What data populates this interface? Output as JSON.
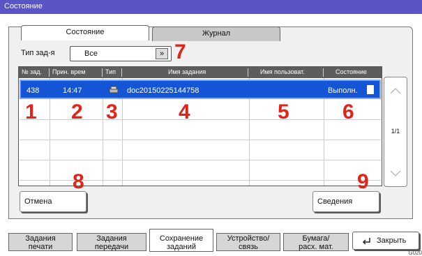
{
  "window": {
    "title": "Состояние"
  },
  "tabs": [
    {
      "label": "Состояние",
      "active": true
    },
    {
      "label": "Журнал",
      "active": false
    }
  ],
  "filter": {
    "label": "Тип зад-я",
    "value": "Все",
    "arrow": "»"
  },
  "table": {
    "columns": [
      "№ зад.",
      "Прин. врем",
      "Тип",
      "Имя задания",
      "Имя пользоват.",
      "Состояние"
    ],
    "rows": [
      {
        "id": "438",
        "time": "14:47",
        "type_icon": "scan-icon",
        "name": "doc20150225144758",
        "user": "",
        "status": "Выполн."
      }
    ]
  },
  "scroll": {
    "page_indicator": "1/1"
  },
  "markers": [
    "1",
    "2",
    "3",
    "4",
    "5",
    "6",
    "7",
    "8",
    "9"
  ],
  "buttons": {
    "cancel": "Отмена",
    "details": "Сведения"
  },
  "bottom_tabs": [
    {
      "label_line1": "Задания",
      "label_line2": "печати",
      "active": false
    },
    {
      "label_line1": "Задания",
      "label_line2": "передачи",
      "active": false
    },
    {
      "label_line1": "Сохранение",
      "label_line2": "заданий",
      "active": true
    },
    {
      "label_line1": "Устройство/",
      "label_line2": "связь",
      "active": false
    },
    {
      "label_line1": "Бумага/",
      "label_line2": "расх. мат.",
      "active": false
    }
  ],
  "close_button": {
    "label": "Закрыть"
  },
  "footer_code": "G020",
  "colors": {
    "titlebar": "#5a55c4",
    "selected_row": "#1455d6",
    "marker": "#e2231a",
    "header": "#5d5d5d"
  }
}
